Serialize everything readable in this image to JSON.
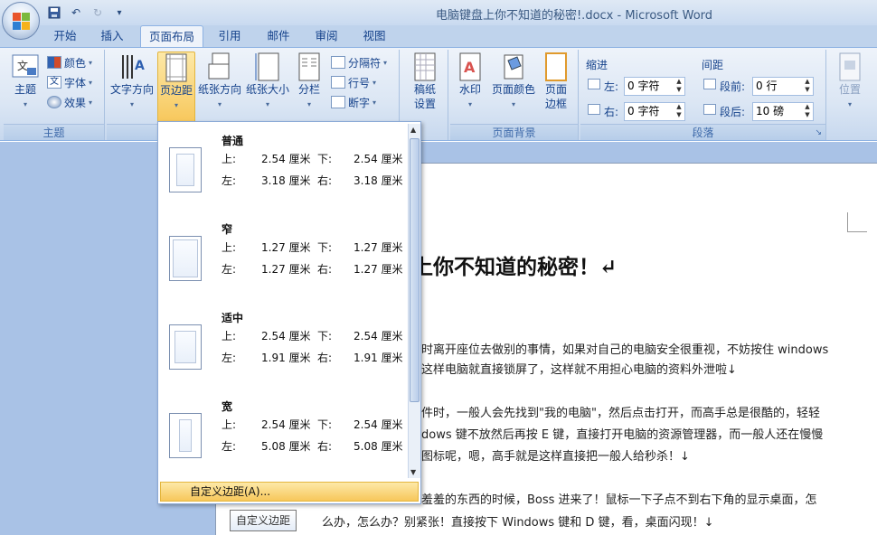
{
  "window": {
    "title": "电脑键盘上你不知道的秘密!.docx - Microsoft Word"
  },
  "tabs": [
    {
      "label": "开始",
      "active": false
    },
    {
      "label": "插入",
      "active": false
    },
    {
      "label": "页面布局",
      "active": true
    },
    {
      "label": "引用",
      "active": false
    },
    {
      "label": "邮件",
      "active": false
    },
    {
      "label": "审阅",
      "active": false
    },
    {
      "label": "视图",
      "active": false
    }
  ],
  "ribbon": {
    "theme_group": {
      "label": "主题",
      "theme_btn": "主题",
      "colors": "颜色",
      "fonts": "字体",
      "effects": "效果"
    },
    "page_setup_group": {
      "text_direction": "文字方向",
      "margins": "页边距",
      "orientation": "纸张方向",
      "size": "纸张大小",
      "columns": "分栏",
      "breaks": "分隔符",
      "line_numbers": "行号",
      "hyphenation": "断字",
      "label_partial": "纸"
    },
    "watermark_group": {
      "watermark_line1": "稿纸",
      "watermark_line2": "设置"
    },
    "page_background_group": {
      "label": "页面背景",
      "watermark": "水印",
      "page_color": "页面颜色",
      "page_border_line1": "页面",
      "page_border_line2": "边框"
    },
    "paragraph_group": {
      "label": "段落",
      "indent_title": "缩进",
      "spacing_title": "间距",
      "indent_left_label": "左:",
      "indent_left_value": "0 字符",
      "indent_right_label": "右:",
      "indent_right_value": "0 字符",
      "spacing_before_label": "段前:",
      "spacing_before_value": "0 行",
      "spacing_after_label": "段后:",
      "spacing_after_value": "10 磅"
    },
    "arrange_group": {
      "position": "位置"
    }
  },
  "margins_dropdown": {
    "presets": [
      {
        "name": "普通",
        "top_label": "上:",
        "top": "2.54 厘米",
        "bottom_label": "下:",
        "bottom": "2.54 厘米",
        "left_label": "左:",
        "left": "3.18 厘米",
        "right_label": "右:",
        "right": "3.18 厘米"
      },
      {
        "name": "窄",
        "top_label": "上:",
        "top": "1.27 厘米",
        "bottom_label": "下:",
        "bottom": "1.27 厘米",
        "left_label": "左:",
        "left": "1.27 厘米",
        "right_label": "右:",
        "right": "1.27 厘米"
      },
      {
        "name": "适中",
        "top_label": "上:",
        "top": "2.54 厘米",
        "bottom_label": "下:",
        "bottom": "2.54 厘米",
        "left_label": "左:",
        "left": "1.91 厘米",
        "right_label": "右:",
        "right": "1.91 厘米"
      },
      {
        "name": "宽",
        "top_label": "上:",
        "top": "2.54 厘米",
        "bottom_label": "下:",
        "bottom": "2.54 厘米",
        "left_label": "左:",
        "left": "5.08 厘米",
        "right_label": "右:",
        "right": "5.08 厘米"
      }
    ],
    "custom_label": "自定义边距(A)..."
  },
  "tooltip": "自定义边距",
  "document": {
    "title_partial": "上你不知道的秘密！↵",
    "lines": [
      "时离开座位去做别的事情，如果对自己的电脑安全很重视，不妨按住 windows",
      "这样电脑就直接锁屏了，这样就不用担心电脑的资料外泄啦↓",
      "件时，一般人会先找到\"我的电脑\"，然后点击打开，而高手总是很酷的，轻轻",
      "dows 键不放然后再按 E 键，直接打开电脑的资源管理器，而一般人还在慢慢",
      "图标呢，嗯，高手就是这样直接把一般人给秒杀！↓",
      "羞羞的东西的时候，Boss 进来了！鼠标一下子点不到右下角的显示桌面，怎",
      "么办，怎么办？别紧张！直接按下 Windows 键和 D 键，看，桌面闪现！↓"
    ]
  }
}
